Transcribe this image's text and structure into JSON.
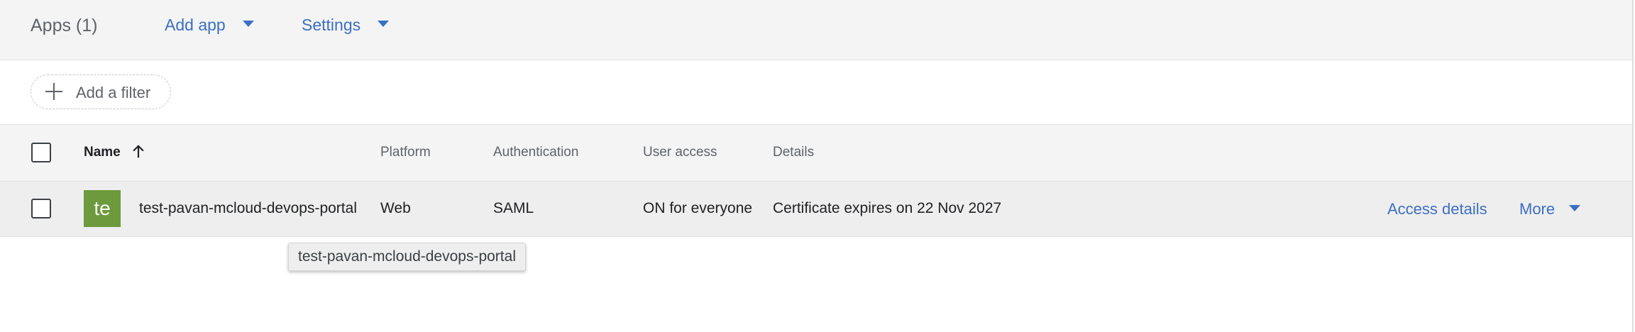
{
  "header": {
    "title": "Apps (1)",
    "add_app_label": "Add app",
    "settings_label": "Settings"
  },
  "filter": {
    "add_filter_label": "Add a filter"
  },
  "table": {
    "columns": {
      "name": "Name",
      "platform": "Platform",
      "authentication": "Authentication",
      "user_access": "User access",
      "details": "Details"
    },
    "sort": {
      "column": "name",
      "direction": "ascending"
    },
    "rows": [
      {
        "avatar_text": "te",
        "avatar_color": "#6c9a3c",
        "name": "test-pavan-mcloud-devops-portal",
        "platform": "Web",
        "authentication": "SAML",
        "user_access": "ON for everyone",
        "details": "Certificate expires on 22 Nov 2027",
        "access_details_label": "Access details",
        "more_label": "More"
      }
    ]
  },
  "tooltip": {
    "text": "test-pavan-mcloud-devops-portal"
  },
  "colors": {
    "accent": "#3c6fc4",
    "header_bg": "#f4f4f4",
    "row_hover_bg": "#eeeeee"
  }
}
